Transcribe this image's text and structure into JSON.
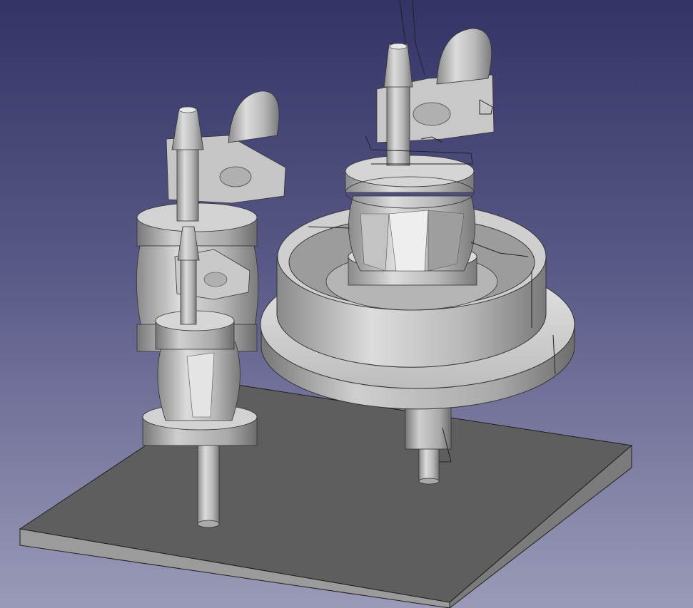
{
  "app": {
    "view": "3D viewport",
    "background": {
      "top": "#333366",
      "bottom": "#9a9ab8"
    }
  },
  "scene": {
    "objects": [
      {
        "name": "base-plate",
        "color": "#5d5d5d"
      },
      {
        "name": "assembly-left-rear",
        "color": "#bdbdbd"
      },
      {
        "name": "assembly-left-front",
        "color": "#c4c4c4"
      },
      {
        "name": "assembly-right-disc",
        "color": "#b8b8b8"
      },
      {
        "name": "wireframe-helper",
        "color": "#222222"
      }
    ]
  }
}
